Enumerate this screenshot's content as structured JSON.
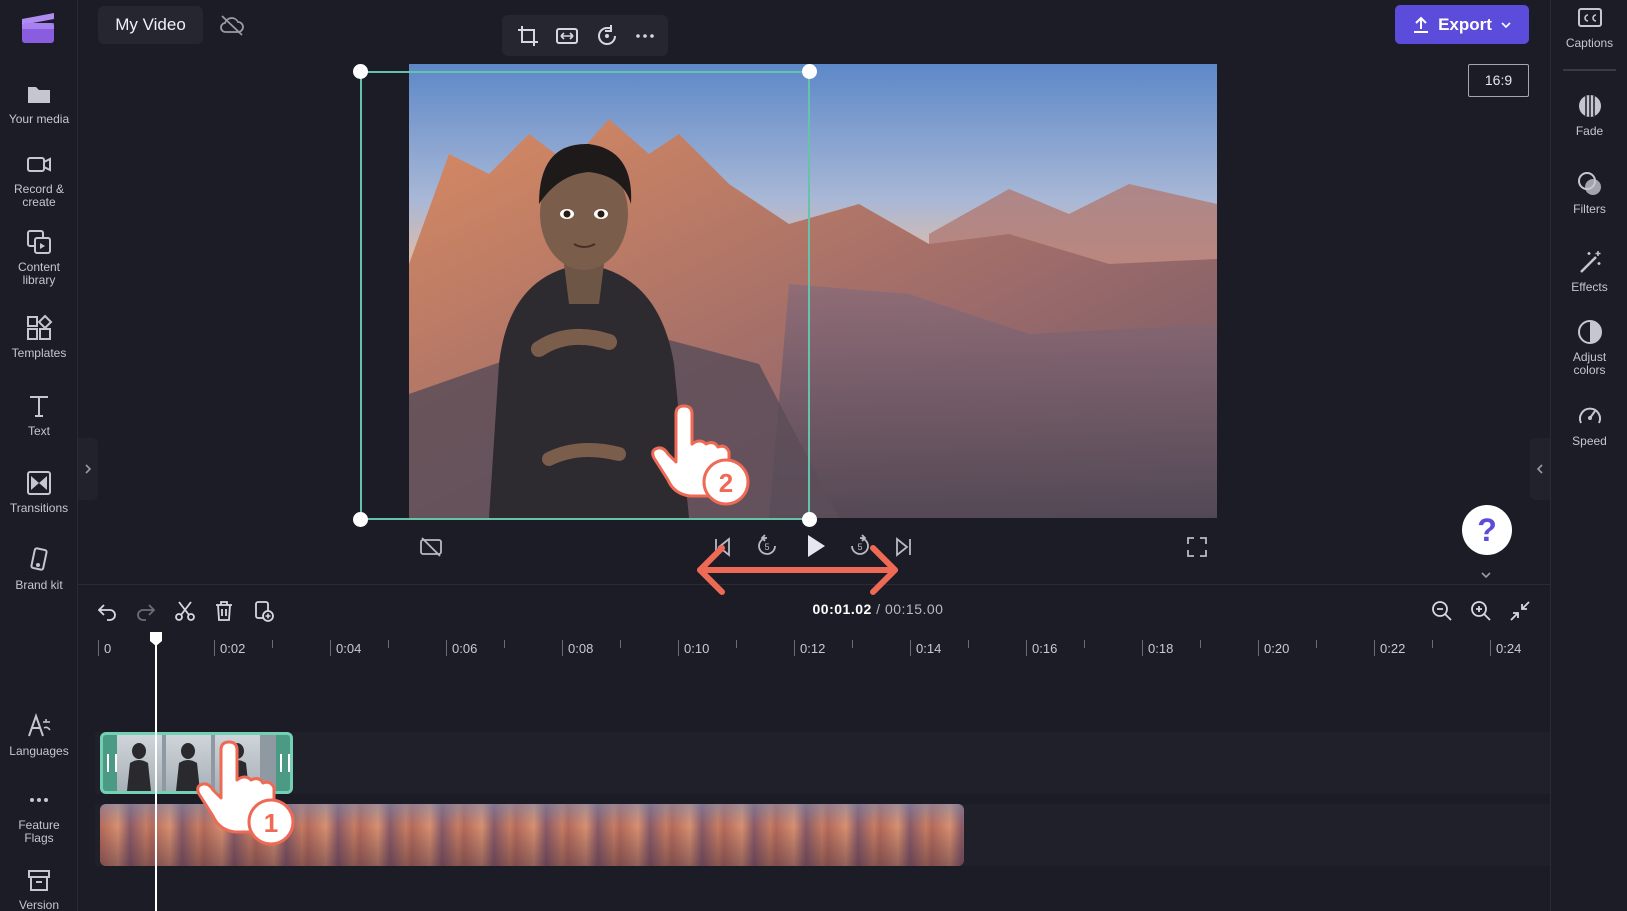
{
  "window": {
    "title": "My Video"
  },
  "left_sidebar": {
    "items": [
      {
        "label": "Your media",
        "icon": "folder-icon"
      },
      {
        "label": "Record &\ncreate",
        "icon": "camera-icon"
      },
      {
        "label": "Content\nlibrary",
        "icon": "content-library-icon"
      },
      {
        "label": "Templates",
        "icon": "templates-icon"
      },
      {
        "label": "Text",
        "icon": "text-icon"
      },
      {
        "label": "Transitions",
        "icon": "transitions-icon"
      },
      {
        "label": "Brand kit",
        "icon": "brand-kit-icon"
      },
      {
        "label": "Languages",
        "icon": "languages-icon"
      },
      {
        "label": "Feature\nFlags",
        "icon": "more-icon"
      },
      {
        "label": "Version",
        "icon": "version-icon"
      }
    ]
  },
  "right_sidebar": {
    "items": [
      {
        "label": "Captions",
        "icon": "captions-icon"
      },
      {
        "label": "Fade",
        "icon": "fade-icon"
      },
      {
        "label": "Filters",
        "icon": "filters-icon"
      },
      {
        "label": "Effects",
        "icon": "effects-icon"
      },
      {
        "label": "Adjust\ncolors",
        "icon": "adjust-colors-icon"
      },
      {
        "label": "Speed",
        "icon": "speed-icon"
      }
    ]
  },
  "toolbar": {
    "export_label": "Export",
    "aspect_ratio": "16:9",
    "preview_tools": [
      "crop-icon",
      "fit-icon",
      "rotate-icon",
      "more-icon"
    ]
  },
  "playback": {
    "current_time": "00:01.02",
    "separator": " / ",
    "total_time": "00:15.00",
    "controls": [
      "captions-off-icon",
      "skip-back-icon",
      "rewind-5-icon",
      "play-icon",
      "forward-5-icon",
      "skip-forward-icon",
      "fullscreen-icon"
    ]
  },
  "timeline": {
    "ruler_labels": [
      "0",
      "0:02",
      "0:04",
      "0:06",
      "0:08",
      "0:10",
      "0:12",
      "0:14",
      "0:16",
      "0:18",
      "0:20",
      "0:22",
      "0:24"
    ],
    "tools": [
      "undo-icon",
      "redo-icon",
      "split-icon",
      "delete-icon",
      "duplicate-icon",
      "zoom-out-icon",
      "zoom-in-icon",
      "fit-timeline-icon"
    ]
  },
  "annotations": {
    "step1": "1",
    "step2": "2"
  },
  "help": {
    "label": "?"
  },
  "colors": {
    "accent": "#5b4cdb",
    "selection": "#64c3a8",
    "annotation": "#ef6a55",
    "background": "#1c1c26"
  }
}
